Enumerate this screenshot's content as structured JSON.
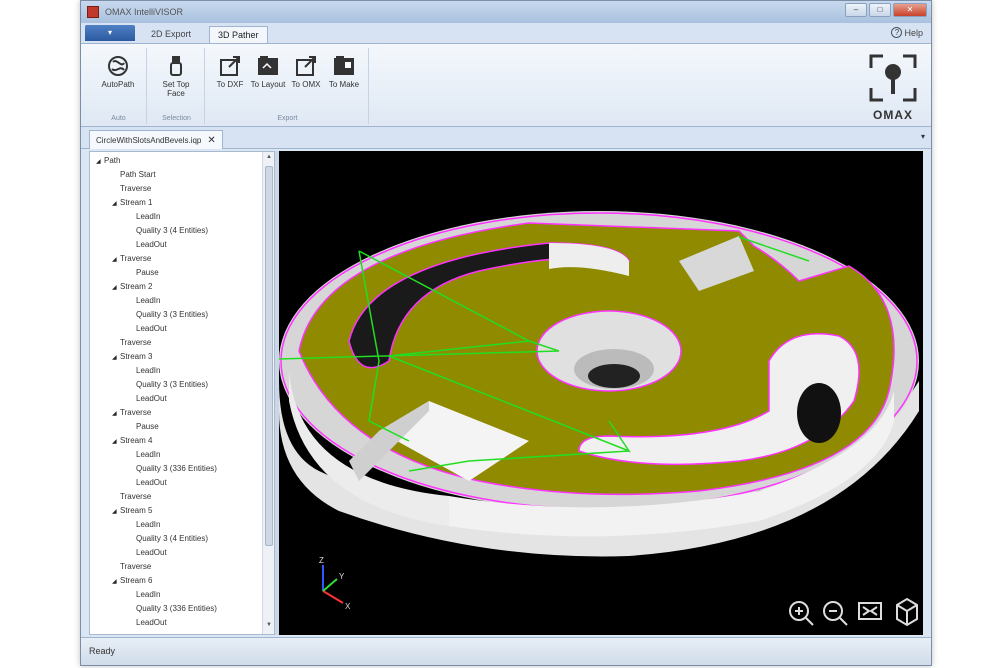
{
  "window": {
    "title": "OMAX IntelliVISOR",
    "controls": {
      "minimize": "–",
      "maximize": "□",
      "close": "✕"
    }
  },
  "ribbon_tabs": {
    "app_menu": "▾",
    "tabs": [
      "2D Export",
      "3D Pather"
    ],
    "help": "Help"
  },
  "ribbon": {
    "groups": [
      {
        "label": "Auto",
        "buttons": [
          {
            "label": "AutoPath",
            "icon": "autopath-icon"
          }
        ]
      },
      {
        "label": "Selection",
        "buttons": [
          {
            "label": "Set Top Face",
            "icon": "set-top-face-icon"
          }
        ]
      },
      {
        "label": "Export",
        "buttons": [
          {
            "label": "To DXF",
            "icon": "export-arrow-icon"
          },
          {
            "label": "To Layout",
            "icon": "layout-icon"
          },
          {
            "label": "To OMX",
            "icon": "export-arrow-icon"
          },
          {
            "label": "To Make",
            "icon": "make-icon"
          }
        ]
      }
    ],
    "logo": "OMAX"
  },
  "document": {
    "tab": "CircleWithSlotsAndBevels.iqp",
    "close": "✕",
    "dropdown": "▾"
  },
  "tree": {
    "items": [
      {
        "label": "Path",
        "level": 0,
        "expander": "◢"
      },
      {
        "label": "Path Start",
        "level": 1,
        "expander": ""
      },
      {
        "label": "Traverse",
        "level": 1,
        "expander": ""
      },
      {
        "label": "Stream 1",
        "level": 1,
        "expander": "◢"
      },
      {
        "label": "LeadIn",
        "level": 2,
        "expander": ""
      },
      {
        "label": "Quality 3 (4 Entities)",
        "level": 2,
        "expander": ""
      },
      {
        "label": "LeadOut",
        "level": 2,
        "expander": ""
      },
      {
        "label": "Traverse",
        "level": 1,
        "expander": "◢"
      },
      {
        "label": "Pause",
        "level": 2,
        "expander": ""
      },
      {
        "label": "Stream 2",
        "level": 1,
        "expander": "◢"
      },
      {
        "label": "LeadIn",
        "level": 2,
        "expander": ""
      },
      {
        "label": "Quality 3 (3 Entities)",
        "level": 2,
        "expander": ""
      },
      {
        "label": "LeadOut",
        "level": 2,
        "expander": ""
      },
      {
        "label": "Traverse",
        "level": 1,
        "expander": ""
      },
      {
        "label": "Stream 3",
        "level": 1,
        "expander": "◢"
      },
      {
        "label": "LeadIn",
        "level": 2,
        "expander": ""
      },
      {
        "label": "Quality 3 (3 Entities)",
        "level": 2,
        "expander": ""
      },
      {
        "label": "LeadOut",
        "level": 2,
        "expander": ""
      },
      {
        "label": "Traverse",
        "level": 1,
        "expander": "◢"
      },
      {
        "label": "Pause",
        "level": 2,
        "expander": ""
      },
      {
        "label": "Stream 4",
        "level": 1,
        "expander": "◢"
      },
      {
        "label": "LeadIn",
        "level": 2,
        "expander": ""
      },
      {
        "label": "Quality 3 (336 Entities)",
        "level": 2,
        "expander": ""
      },
      {
        "label": "LeadOut",
        "level": 2,
        "expander": ""
      },
      {
        "label": "Traverse",
        "level": 1,
        "expander": ""
      },
      {
        "label": "Stream 5",
        "level": 1,
        "expander": "◢"
      },
      {
        "label": "LeadIn",
        "level": 2,
        "expander": ""
      },
      {
        "label": "Quality 3 (4 Entities)",
        "level": 2,
        "expander": ""
      },
      {
        "label": "LeadOut",
        "level": 2,
        "expander": ""
      },
      {
        "label": "Traverse",
        "level": 1,
        "expander": ""
      },
      {
        "label": "Stream 6",
        "level": 1,
        "expander": "◢"
      },
      {
        "label": "LeadIn",
        "level": 2,
        "expander": ""
      },
      {
        "label": "Quality 3 (336 Entities)",
        "level": 2,
        "expander": ""
      },
      {
        "label": "LeadOut",
        "level": 2,
        "expander": ""
      }
    ],
    "scroll_up": "▲",
    "scroll_down": "▼"
  },
  "viewport": {
    "axes": {
      "x": "X",
      "y": "Y",
      "z": "Z"
    },
    "tools": [
      "zoom-in-icon",
      "zoom-out-icon",
      "zoom-extents-icon",
      "view-cube-icon"
    ]
  },
  "colors": {
    "top_face": "#8f8a00",
    "side_face": "#e4e4e4",
    "cut_path": "#ff33ff",
    "traverse": "#22dd22",
    "background": "#000000"
  },
  "status": {
    "text": "Ready"
  }
}
